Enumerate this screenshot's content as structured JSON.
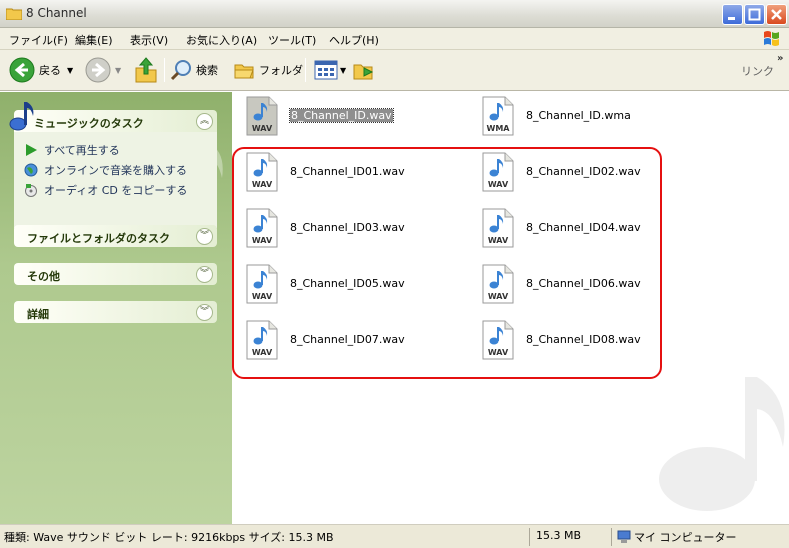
{
  "window": {
    "title": "8 Channel"
  },
  "menu": [
    "ファイル(F)",
    "編集(E)",
    "表示(V)",
    "お気に入り(A)",
    "ツール(T)",
    "ヘルプ(H)"
  ],
  "toolbar": {
    "back_label": "戻る",
    "search_label": "検索",
    "folder_label": "フォルダ",
    "links_label": "リンク"
  },
  "tasks": {
    "music": {
      "title": "ミュージックのタスク",
      "items": [
        "すべて再生する",
        "オンラインで音楽を購入する",
        "オーディオ CD をコピーする"
      ]
    },
    "file_folder": {
      "title": "ファイルとフォルダのタスク"
    },
    "other": {
      "title": "その他"
    },
    "details": {
      "title": "詳細"
    }
  },
  "files": [
    {
      "name": "8_Channel_ID.wav",
      "type": "WAV"
    },
    {
      "name": "8_Channel_ID.wma",
      "type": "WMA"
    },
    {
      "name": "8_Channel_ID01.wav",
      "type": "WAV"
    },
    {
      "name": "8_Channel_ID02.wav",
      "type": "WAV"
    },
    {
      "name": "8_Channel_ID03.wav",
      "type": "WAV"
    },
    {
      "name": "8_Channel_ID04.wav",
      "type": "WAV"
    },
    {
      "name": "8_Channel_ID05.wav",
      "type": "WAV"
    },
    {
      "name": "8_Channel_ID06.wav",
      "type": "WAV"
    },
    {
      "name": "8_Channel_ID07.wav",
      "type": "WAV"
    },
    {
      "name": "8_Channel_ID08.wav",
      "type": "WAV"
    }
  ],
  "status": {
    "info": "種類: Wave サウンド ビット レート: 9216kbps サイズ: 15.3 MB",
    "size": "15.3 MB",
    "location": "マイ コンピューター"
  },
  "colors": {
    "highlight": "#e51010",
    "pane_green": "#aec98e",
    "task_title": "#233808"
  }
}
